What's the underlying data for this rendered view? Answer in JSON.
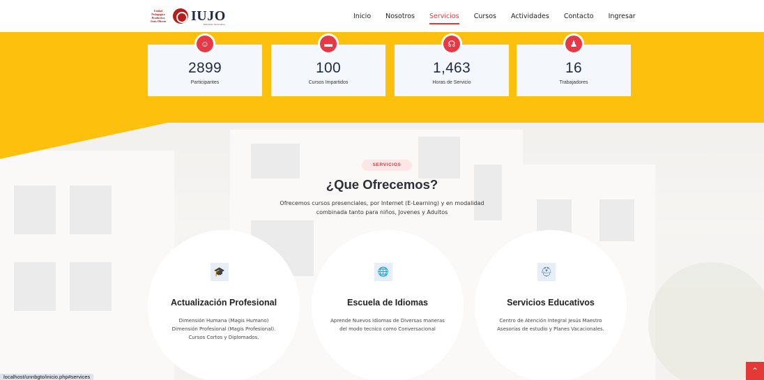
{
  "header": {
    "logo": {
      "sub_lines": [
        "Unidad",
        "Pedagogica",
        "Productiva",
        "Jesús Obrero"
      ],
      "word": "IUJO",
      "tagline": "Educación Venezolana"
    },
    "nav": [
      {
        "label": "Inicio",
        "active": false
      },
      {
        "label": "Nosotros",
        "active": false
      },
      {
        "label": "Servicios",
        "active": true
      },
      {
        "label": "Cursos",
        "active": false
      },
      {
        "label": "Actividades",
        "active": false
      },
      {
        "label": "Contacto",
        "active": false
      },
      {
        "label": "Ingresar",
        "active": false
      }
    ]
  },
  "stats": [
    {
      "icon": "smile-icon",
      "glyph": "☺",
      "value": "2899",
      "label": "Participantes"
    },
    {
      "icon": "toolbox-icon",
      "glyph": "▬",
      "value": "100",
      "label": "Cursos Impartidos"
    },
    {
      "icon": "headset-icon",
      "glyph": "☊",
      "value": "1,463",
      "label": "Horas de Servicio"
    },
    {
      "icon": "users-icon",
      "glyph": "♟",
      "value": "16",
      "label": "Trabajadores"
    }
  ],
  "services": {
    "tag": "SERVICIOS",
    "title": "¿Que Ofrecemos?",
    "description": "Ofrecemos cursos presenciales, por Internet (E-Learning) y en modalidad combinada tanto para niños, Jovenes y Adultos",
    "cards": [
      {
        "icon": "graduation-cap-icon",
        "glyph": "🎓",
        "title": "Actualización Profesional",
        "description": "Dimensión Humana (Magis Humano) Dimensión Profesional (Magis Profesional). Cursos Cortos y Diplomados."
      },
      {
        "icon": "globe-icon",
        "glyph": "🌐",
        "title": "Escuela de Idiomas",
        "description": "Aprende Nuevos Idiomas de Diversas maneras del modo tecnico como Conversacional"
      },
      {
        "icon": "education-icon",
        "glyph": "⛑",
        "title": "Servicios Educativos",
        "description": "Centro de Atención Integral Jesús Maestro Asesorías de estudio y Planes Vacacionales."
      }
    ]
  },
  "status_bar": {
    "url": "localhost/unnbgto/inicio.php#services"
  },
  "scroll_top": {
    "glyph": "⌃"
  },
  "colors": {
    "accent": "#e53935",
    "yellow": "#fdc10d",
    "navy": "#1f2b42",
    "card_icon": "#2f6fc4"
  }
}
